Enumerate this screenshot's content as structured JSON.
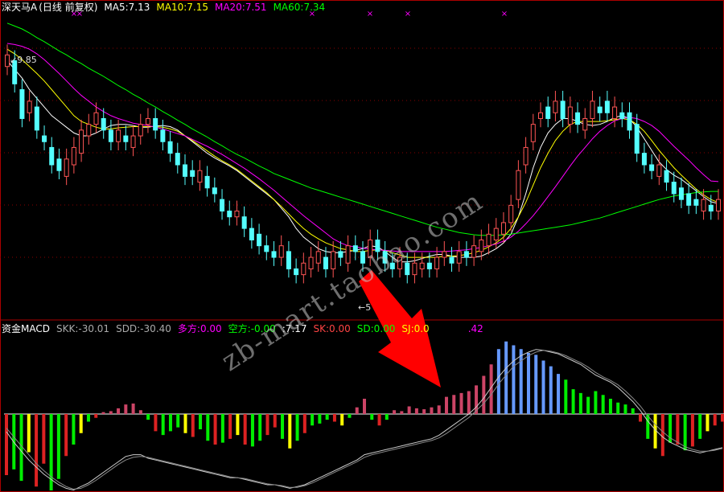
{
  "top_header": {
    "stock": "深天马A",
    "period": "(日线 前复权)",
    "ma5": "MA5:7.13",
    "ma10": "MA10:7.15",
    "ma20": "MA20:7.51",
    "ma60": "MA60:7.34"
  },
  "bottom_header": {
    "name": "资金MACD",
    "skk": "SKK:-30.01",
    "sdd": "SDD:-30.40",
    "duofang": "多方:0.00",
    "kongfang": "空方:-0.00",
    "v717": ":7.17",
    "sk": "SK:0.00",
    "sd": "SD:0.00",
    "sj": "SJ:0.0",
    "tail": ".42"
  },
  "annotations": {
    "high_label": "9.85",
    "low_label": "5"
  },
  "watermark": "zb-mart.taobao.com",
  "colors": {
    "up": "#ff5555",
    "down": "#54ffff",
    "ma5": "#ffffff",
    "ma10": "#ffff00",
    "ma20": "#ff00ff",
    "ma60": "#00ff00",
    "hist_green": "#00ee00",
    "hist_red": "#dd2222",
    "hist_yellow": "#ffff00",
    "hist_pink": "#cc4466",
    "hist_blue": "#6699ff",
    "arrow": "#ff0000"
  },
  "chart_data": [
    {
      "type": "candlestick",
      "title": "深天马A (日线 前复权)",
      "ylim": [
        5.2,
        10.4
      ],
      "series": [
        {
          "name": "MA5",
          "values": [
            9.6,
            9.45,
            9.3,
            9.1,
            8.95,
            8.8,
            8.65,
            8.55,
            8.45,
            8.35,
            8.3,
            8.3,
            8.35,
            8.42,
            8.48,
            8.5,
            8.5,
            8.48,
            8.45,
            8.45,
            8.47,
            8.48,
            8.46,
            8.4,
            8.3,
            8.2,
            8.1,
            8.0,
            7.92,
            7.85,
            7.78,
            7.7,
            7.6,
            7.5,
            7.4,
            7.3,
            7.2,
            7.05,
            6.9,
            6.7,
            6.55,
            6.45,
            6.35,
            6.3,
            6.28,
            6.28,
            6.3,
            6.32,
            6.35,
            6.4,
            6.38,
            6.3,
            6.2,
            6.12,
            6.12,
            6.14,
            6.18,
            6.22,
            6.25,
            6.25,
            6.22,
            6.2,
            6.2,
            6.2,
            6.22,
            6.28,
            6.35,
            6.45,
            6.6,
            6.9,
            7.3,
            7.75,
            8.1,
            8.35,
            8.5,
            8.6,
            8.6,
            8.55,
            8.5,
            8.48,
            8.5,
            8.55,
            8.62,
            8.65,
            8.6,
            8.45,
            8.25,
            8.05,
            7.85,
            7.72,
            7.62,
            7.55,
            7.45,
            7.35,
            7.25,
            7.16,
            7.13
          ]
        },
        {
          "name": "MA10",
          "values": [
            9.8,
            9.72,
            9.62,
            9.5,
            9.38,
            9.25,
            9.1,
            8.95,
            8.8,
            8.65,
            8.55,
            8.5,
            8.45,
            8.42,
            8.42,
            8.44,
            8.45,
            8.46,
            8.46,
            8.46,
            8.46,
            8.45,
            8.42,
            8.38,
            8.3,
            8.22,
            8.13,
            8.04,
            7.95,
            7.87,
            7.8,
            7.72,
            7.62,
            7.52,
            7.42,
            7.32,
            7.2,
            7.08,
            6.95,
            6.82,
            6.7,
            6.6,
            6.52,
            6.45,
            6.4,
            6.35,
            6.33,
            6.3,
            6.3,
            6.32,
            6.33,
            6.32,
            6.28,
            6.24,
            6.2,
            6.2,
            6.2,
            6.2,
            6.2,
            6.22,
            6.22,
            6.23,
            6.25,
            6.28,
            6.32,
            6.38,
            6.45,
            6.55,
            6.7,
            6.9,
            7.15,
            7.45,
            7.75,
            8.0,
            8.22,
            8.38,
            8.5,
            8.55,
            8.55,
            8.55,
            8.55,
            8.56,
            8.58,
            8.6,
            8.58,
            8.5,
            8.38,
            8.22,
            8.05,
            7.9,
            7.75,
            7.62,
            7.5,
            7.38,
            7.28,
            7.2,
            7.15
          ]
        },
        {
          "name": "MA20",
          "values": [
            9.9,
            9.88,
            9.85,
            9.8,
            9.72,
            9.62,
            9.5,
            9.38,
            9.25,
            9.12,
            9.0,
            8.9,
            8.8,
            8.72,
            8.65,
            8.6,
            8.56,
            8.52,
            8.5,
            8.48,
            8.45,
            8.42,
            8.38,
            8.34,
            8.3,
            8.24,
            8.18,
            8.12,
            8.05,
            7.98,
            7.9,
            7.82,
            7.74,
            7.65,
            7.56,
            7.46,
            7.36,
            7.25,
            7.14,
            7.03,
            6.92,
            6.82,
            6.72,
            6.62,
            6.52,
            6.45,
            6.4,
            6.38,
            6.36,
            6.34,
            6.33,
            6.32,
            6.31,
            6.3,
            6.3,
            6.3,
            6.3,
            6.3,
            6.3,
            6.3,
            6.31,
            6.32,
            6.33,
            6.35,
            6.37,
            6.4,
            6.43,
            6.48,
            6.55,
            6.65,
            6.78,
            6.92,
            7.08,
            7.25,
            7.42,
            7.6,
            7.78,
            7.95,
            8.1,
            8.25,
            8.38,
            8.48,
            8.56,
            8.6,
            8.62,
            8.6,
            8.55,
            8.48,
            8.38,
            8.25,
            8.12,
            8.0,
            7.88,
            7.75,
            7.63,
            7.52,
            7.51
          ]
        },
        {
          "name": "MA60",
          "values": [
            10.25,
            10.2,
            10.15,
            10.08,
            10.0,
            9.93,
            9.85,
            9.77,
            9.7,
            9.62,
            9.55,
            9.47,
            9.4,
            9.33,
            9.25,
            9.17,
            9.1,
            9.02,
            8.95,
            8.87,
            8.8,
            8.72,
            8.65,
            8.57,
            8.5,
            8.42,
            8.35,
            8.28,
            8.2,
            8.13,
            8.05,
            7.98,
            7.92,
            7.85,
            7.78,
            7.72,
            7.65,
            7.6,
            7.55,
            7.5,
            7.45,
            7.4,
            7.36,
            7.32,
            7.28,
            7.24,
            7.2,
            7.16,
            7.12,
            7.08,
            7.04,
            7.0,
            6.96,
            6.92,
            6.88,
            6.84,
            6.8,
            6.76,
            6.72,
            6.69,
            6.66,
            6.63,
            6.61,
            6.59,
            6.58,
            6.58,
            6.58,
            6.59,
            6.6,
            6.62,
            6.64,
            6.66,
            6.68,
            6.7,
            6.72,
            6.74,
            6.76,
            6.79,
            6.82,
            6.85,
            6.88,
            6.92,
            6.96,
            7.0,
            7.04,
            7.08,
            7.12,
            7.16,
            7.2,
            7.23,
            7.26,
            7.28,
            7.3,
            7.32,
            7.33,
            7.34,
            7.34
          ]
        }
      ],
      "candles": {
        "open": [
          9.5,
          9.6,
          9.1,
          8.7,
          8.8,
          8.3,
          8.1,
          7.9,
          7.6,
          7.8,
          8.0,
          8.3,
          8.5,
          8.6,
          8.4,
          8.2,
          8.3,
          8.1,
          8.3,
          8.5,
          8.6,
          8.4,
          8.2,
          8.0,
          7.8,
          7.7,
          7.5,
          7.6,
          7.4,
          7.2,
          7.0,
          6.9,
          6.9,
          6.7,
          6.6,
          6.4,
          6.3,
          6.2,
          6.3,
          6.0,
          5.9,
          6.0,
          6.1,
          6.2,
          6.0,
          6.3,
          6.1,
          6.4,
          6.3,
          6.2,
          6.5,
          6.3,
          6.1,
          6.0,
          6.1,
          5.9,
          6.0,
          6.1,
          6.0,
          6.2,
          6.2,
          6.1,
          6.3,
          6.2,
          6.3,
          6.4,
          6.5,
          6.6,
          6.8,
          7.2,
          7.8,
          8.2,
          8.6,
          8.8,
          8.7,
          8.9,
          8.5,
          8.7,
          8.4,
          8.6,
          8.8,
          8.9,
          8.6,
          8.7,
          8.7,
          8.5,
          8.0,
          7.8,
          7.6,
          7.7,
          7.5,
          7.4,
          7.3,
          7.2,
          7.0,
          7.1,
          7.0
        ],
        "close": [
          9.7,
          9.2,
          8.6,
          8.9,
          8.4,
          8.2,
          7.8,
          7.7,
          7.9,
          8.1,
          8.4,
          8.5,
          8.7,
          8.4,
          8.2,
          8.4,
          8.2,
          8.3,
          8.5,
          8.6,
          8.4,
          8.2,
          8.0,
          7.8,
          7.6,
          7.6,
          7.7,
          7.4,
          7.3,
          7.0,
          6.9,
          7.0,
          6.7,
          6.5,
          6.4,
          6.3,
          6.2,
          6.4,
          6.0,
          5.9,
          6.1,
          6.2,
          6.3,
          6.0,
          6.3,
          6.2,
          6.4,
          6.3,
          6.1,
          6.5,
          6.3,
          6.1,
          6.0,
          6.2,
          5.9,
          6.1,
          6.1,
          6.0,
          6.2,
          6.3,
          6.1,
          6.3,
          6.2,
          6.4,
          6.5,
          6.6,
          6.7,
          6.8,
          7.1,
          7.7,
          8.1,
          8.5,
          8.7,
          8.6,
          8.9,
          8.6,
          8.8,
          8.5,
          8.6,
          8.9,
          8.7,
          8.7,
          8.8,
          8.6,
          8.4,
          8.0,
          7.8,
          7.7,
          7.8,
          7.5,
          7.3,
          7.2,
          7.1,
          7.1,
          7.2,
          7.0,
          7.2
        ]
      }
    },
    {
      "type": "bar",
      "title": "资金MACD",
      "ylim": [
        -4.5,
        4
      ],
      "values": [
        -3.2,
        -2.9,
        -3.5,
        -2.0,
        -3.8,
        -2.6,
        -4.0,
        -3.4,
        -2.2,
        -1.6,
        -1.0,
        -0.4,
        -0.2,
        0.1,
        0.15,
        0.3,
        0.5,
        0.55,
        0.2,
        -0.3,
        -0.9,
        -1.1,
        -0.9,
        -0.7,
        -1.0,
        -1.2,
        -0.8,
        -1.4,
        -1.6,
        -1.5,
        -1.3,
        -1.1,
        -1.6,
        -1.7,
        -1.4,
        -1.1,
        -0.7,
        -1.3,
        -1.8,
        -1.4,
        -1.0,
        -0.6,
        -0.5,
        -0.3,
        -0.4,
        -0.6,
        -0.2,
        0.35,
        0.8,
        -0.3,
        -0.6,
        -0.3,
        0.2,
        0.15,
        0.4,
        0.3,
        0.25,
        0.35,
        0.45,
        0.9,
        1.0,
        1.1,
        1.2,
        1.5,
        2.0,
        2.6,
        3.4,
        3.8,
        3.6,
        3.4,
        3.2,
        3.1,
        2.8,
        2.5,
        2.1,
        1.8,
        1.3,
        1.1,
        0.9,
        1.2,
        1.0,
        0.8,
        0.6,
        0.5,
        0.3,
        -0.4,
        -1.3,
        -1.8,
        -2.2,
        -1.5,
        -1.6,
        -1.9,
        -1.7,
        -1.3,
        -0.9,
        -0.6,
        -0.4
      ],
      "series": [
        {
          "name": "SKK",
          "values": [
            -1.0,
            -1.6,
            -2.1,
            -2.6,
            -3.0,
            -3.4,
            -3.7,
            -4.0,
            -4.2,
            -4.3,
            -4.1,
            -3.9,
            -3.6,
            -3.3,
            -3.0,
            -2.7,
            -2.4,
            -2.3,
            -2.3,
            -2.5,
            -2.6,
            -2.7,
            -2.8,
            -2.9,
            -3.0,
            -3.1,
            -3.2,
            -3.3,
            -3.4,
            -3.5,
            -3.6,
            -3.6,
            -3.7,
            -3.8,
            -3.9,
            -4.0,
            -4.0,
            -4.1,
            -4.2,
            -4.1,
            -4.0,
            -3.8,
            -3.6,
            -3.4,
            -3.2,
            -3.0,
            -2.8,
            -2.6,
            -2.3,
            -2.2,
            -2.1,
            -2.0,
            -1.9,
            -1.8,
            -1.7,
            -1.6,
            -1.5,
            -1.4,
            -1.2,
            -0.9,
            -0.6,
            -0.3,
            0.0,
            0.4,
            0.9,
            1.5,
            2.1,
            2.6,
            3.0,
            3.3,
            3.5,
            3.65,
            3.6,
            3.5,
            3.4,
            3.2,
            3.0,
            2.8,
            2.5,
            2.2,
            2.0,
            1.8,
            1.5,
            1.1,
            0.7,
            0.2,
            -0.4,
            -0.9,
            -1.3,
            -1.6,
            -1.8,
            -2.0,
            -2.1,
            -2.2,
            -2.1,
            -2.0,
            -1.9
          ]
        },
        {
          "name": "SDD",
          "values": [
            -0.8,
            -1.3,
            -1.8,
            -2.3,
            -2.8,
            -3.2,
            -3.55,
            -3.85,
            -4.1,
            -4.25,
            -4.2,
            -4.0,
            -3.75,
            -3.45,
            -3.15,
            -2.85,
            -2.6,
            -2.45,
            -2.4,
            -2.45,
            -2.55,
            -2.65,
            -2.75,
            -2.85,
            -2.95,
            -3.05,
            -3.15,
            -3.25,
            -3.35,
            -3.45,
            -3.55,
            -3.6,
            -3.65,
            -3.75,
            -3.85,
            -3.95,
            -4.0,
            -4.05,
            -4.15,
            -4.15,
            -4.05,
            -3.9,
            -3.7,
            -3.5,
            -3.3,
            -3.1,
            -2.9,
            -2.7,
            -2.45,
            -2.3,
            -2.2,
            -2.1,
            -2.0,
            -1.9,
            -1.8,
            -1.7,
            -1.6,
            -1.5,
            -1.35,
            -1.1,
            -0.8,
            -0.5,
            -0.2,
            0.2,
            0.6,
            1.1,
            1.7,
            2.2,
            2.7,
            3.0,
            3.3,
            3.5,
            3.6,
            3.55,
            3.45,
            3.3,
            3.1,
            2.9,
            2.65,
            2.35,
            2.1,
            1.9,
            1.65,
            1.3,
            0.9,
            0.45,
            -0.1,
            -0.6,
            -1.0,
            -1.35,
            -1.6,
            -1.85,
            -2.0,
            -2.1,
            -2.1,
            -2.05,
            -1.95
          ]
        }
      ]
    }
  ]
}
